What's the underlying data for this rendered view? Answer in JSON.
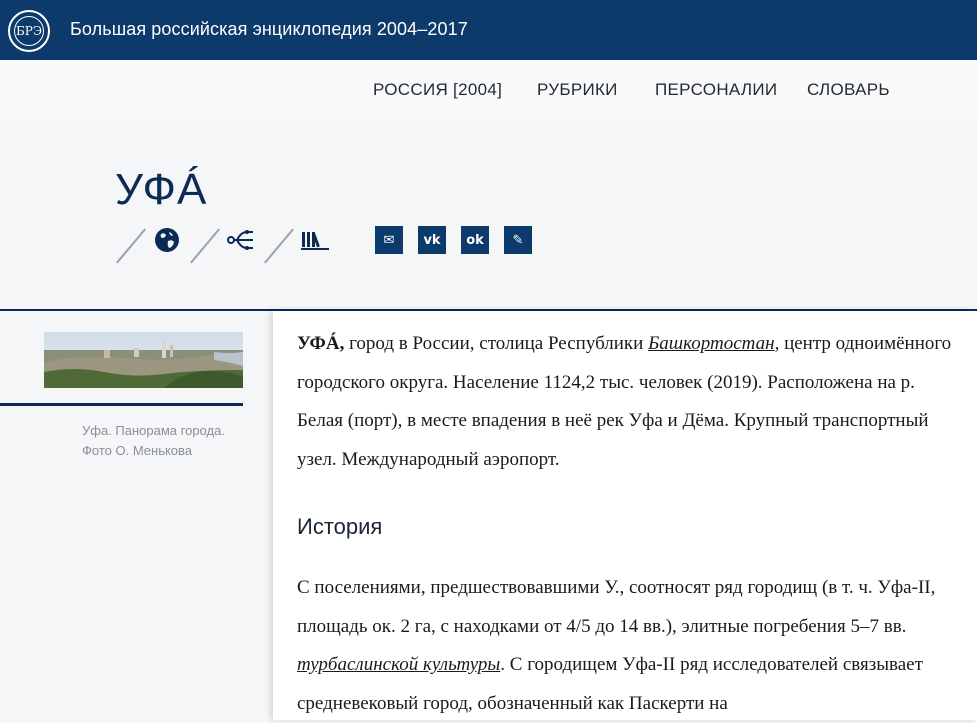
{
  "header": {
    "logo_text": "БРЭ",
    "site_title": "Большая российская энциклопедия 2004–2017"
  },
  "nav": {
    "items": [
      {
        "label": "РОССИЯ [2004]"
      },
      {
        "label": "РУБРИКИ"
      },
      {
        "label": "ПЕРСОНАЛИИ"
      },
      {
        "label": "СЛОВАРЬ"
      }
    ]
  },
  "article": {
    "title": "УФÁ",
    "tools": [
      "globe-icon",
      "share-network-icon",
      "library-icon"
    ],
    "share": [
      {
        "icon": "mail-icon",
        "glyph": "✉"
      },
      {
        "icon": "vk-icon",
        "glyph": "vk"
      },
      {
        "icon": "odnoklassniki-icon",
        "glyph": "ok"
      },
      {
        "icon": "livejournal-icon",
        "glyph": "✎"
      }
    ],
    "image_caption_line1": "Уфа. Панорама города.",
    "image_caption_line2": "Фото О. Менькова",
    "intro": {
      "term": "УФÁ,",
      "text1": " город в России, столица Республики ",
      "link1": "Башкортостан",
      "text2": ", центр одноимённого городского округа. Население 1124,2 тыс. человек (2019). Расположена на р. Белая (порт), в месте впадения в неё рек Уфа и Дёма. Крупный транспортный узел. Международный аэропорт."
    },
    "section_title": "История",
    "history": {
      "text1": "С поселениями, предшествовавшими У., соотносят ряд городищ (в т. ч. Уфа-II, площадь ок. 2 га, с находками от 4/5 до 14 вв.), элитные погребения 5–7 вв. ",
      "link1": "турбаслинской культуры",
      "text2": ". С городищем Уфа-II ряд исследователей связывает средневековый город, обозначенный как Паскерти на"
    }
  }
}
